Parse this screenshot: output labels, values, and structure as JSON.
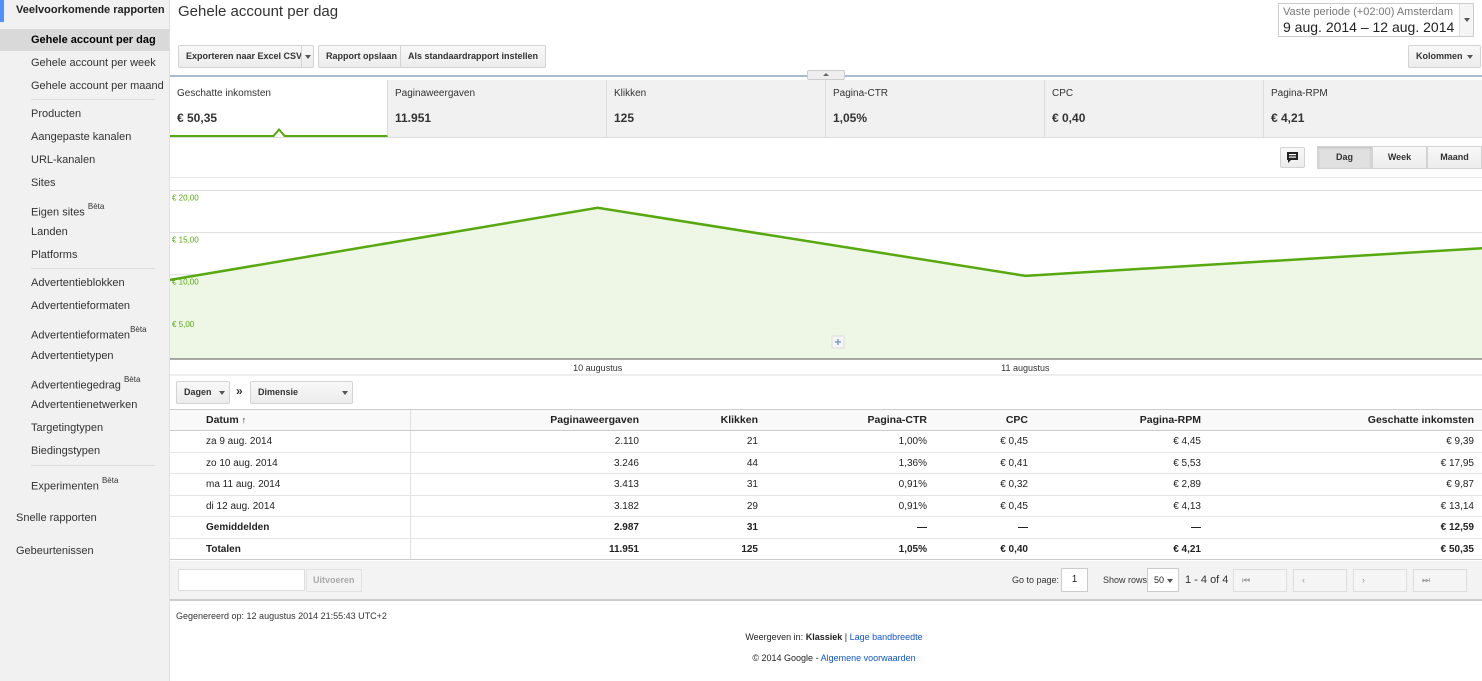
{
  "sidebar": {
    "section_title": "Veelvoorkomende rapporten",
    "items": [
      {
        "label": "Gehele account per dag",
        "active": true,
        "beta": ""
      },
      {
        "label": "Gehele account per week",
        "beta": ""
      },
      {
        "label": "Gehele account per maand",
        "beta": ""
      },
      {
        "label": "Producten",
        "beta": ""
      },
      {
        "label": "Aangepaste kanalen",
        "beta": ""
      },
      {
        "label": "URL-kanalen",
        "beta": ""
      },
      {
        "label": "Sites",
        "beta": ""
      },
      {
        "label": "Eigen sites",
        "beta": "Bèta"
      },
      {
        "label": "Landen",
        "beta": ""
      },
      {
        "label": "Platforms",
        "beta": ""
      },
      {
        "label": "Advertentieblokken",
        "beta": ""
      },
      {
        "label": "Advertentieformaten",
        "beta": ""
      },
      {
        "label": "Advertentieformaten",
        "beta": "Bèta"
      },
      {
        "label": "Advertentietypen",
        "beta": ""
      },
      {
        "label": "Advertentiegedrag",
        "beta": "Bèta"
      },
      {
        "label": "Advertentienetwerken",
        "beta": ""
      },
      {
        "label": "Targetingtypen",
        "beta": ""
      },
      {
        "label": "Biedingstypen",
        "beta": ""
      },
      {
        "label": "Experimenten",
        "beta": "Bèta"
      }
    ],
    "quick_reports": "Snelle rapporten",
    "events": "Gebeurtenissen"
  },
  "header": {
    "title": "Gehele account per dag",
    "date_label": "Vaste periode (+02:00) Amsterdam",
    "date_range": "9 aug. 2014 – 12 aug. 2014"
  },
  "toolbar": {
    "export": "Exporteren naar Excel CSV",
    "save": "Rapport opslaan",
    "default": "Als standaardrapport instellen",
    "columns": "Kolommen"
  },
  "metrics": [
    {
      "label": "Geschatte inkomsten",
      "value": "€ 50,35",
      "active": true
    },
    {
      "label": "Paginaweergaven",
      "value": "11.951"
    },
    {
      "label": "Klikken",
      "value": "125"
    },
    {
      "label": "Pagina-CTR",
      "value": "1,05%"
    },
    {
      "label": "CPC",
      "value": "€ 0,40"
    },
    {
      "label": "Pagina-RPM",
      "value": "€ 4,21"
    }
  ],
  "granularity": {
    "day": "Dag",
    "week": "Week",
    "month": "Maand",
    "selected": "Dag"
  },
  "chart_data": {
    "type": "area",
    "series": [
      {
        "values": [
          9.39,
          17.95,
          9.87,
          13.14
        ]
      }
    ],
    "x": [
      "9 aug. 2014",
      "10 aug. 2014",
      "11 aug. 2014",
      "12 aug. 2014"
    ],
    "x_tick_labels": [
      "10 augustus",
      "11 augustus"
    ],
    "y_tick_labels": [
      "€ 20,00",
      "€ 15,00",
      "€ 10,00",
      "€ 5,00"
    ],
    "y_ticks": [
      20,
      15,
      10,
      5
    ],
    "ylim": [
      0,
      20
    ],
    "color": "#56a90f",
    "fill": "#eef6e6",
    "grid": true
  },
  "dimension": {
    "primary": "Dagen",
    "sep": "»",
    "add": "Dimensie toevoegen"
  },
  "table": {
    "columns": [
      "Datum",
      "Paginaweergaven",
      "Klikken",
      "Pagina-CTR",
      "CPC",
      "Pagina-RPM",
      "Geschatte inkomsten"
    ],
    "sort_indicator": "↑",
    "rows": [
      [
        "za 9 aug. 2014",
        "2.110",
        "21",
        "1,00%",
        "€ 0,45",
        "€ 4,45",
        "€ 9,39"
      ],
      [
        "zo 10 aug. 2014",
        "3.246",
        "44",
        "1,36%",
        "€ 0,41",
        "€ 5,53",
        "€ 17,95"
      ],
      [
        "ma 11 aug. 2014",
        "3.413",
        "31",
        "0,91%",
        "€ 0,32",
        "€ 2,89",
        "€ 9,87"
      ],
      [
        "di 12 aug. 2014",
        "3.182",
        "29",
        "0,91%",
        "€ 0,45",
        "€ 4,13",
        "€ 13,14"
      ]
    ],
    "averages": [
      "Gemiddelden",
      "2.987",
      "31",
      "—",
      "—",
      "—",
      "€ 12,59"
    ],
    "totals": [
      "Totalen",
      "11.951",
      "125",
      "1,05%",
      "€ 0,40",
      "€ 4,21",
      "€ 50,35"
    ]
  },
  "pager": {
    "apply": "Uitvoeren",
    "goto_label": "Go to page:",
    "page": "1",
    "rows_label": "Show rows:",
    "rows": "50",
    "count": "1 - 4 of 4"
  },
  "footer": {
    "generated": "Gegenereerd op: 12 augustus 2014 21:55:43 UTC+2",
    "view_in": "Weergeven in:",
    "classic": "Klassiek",
    "sep": "|",
    "low_bw": "Lage bandbreedte",
    "copyright": "© 2014 Google",
    "dash": "-",
    "terms": "Algemene voorwaarden"
  }
}
